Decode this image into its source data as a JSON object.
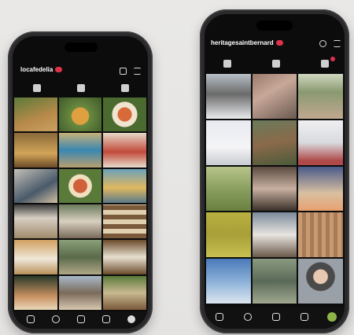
{
  "left_phone": {
    "username": "locafedelia",
    "colors": {
      "notification": "#e0304a"
    }
  },
  "right_phone": {
    "username": "heritagesaintbernard",
    "colors": {
      "notification": "#e0304a"
    }
  },
  "icons": [
    "home-icon",
    "search-icon",
    "add-post-icon",
    "reels-icon",
    "profile-avatar-icon",
    "grid-tab-icon",
    "reels-tab-icon",
    "tagged-tab-icon",
    "add-icon",
    "menu-icon"
  ]
}
